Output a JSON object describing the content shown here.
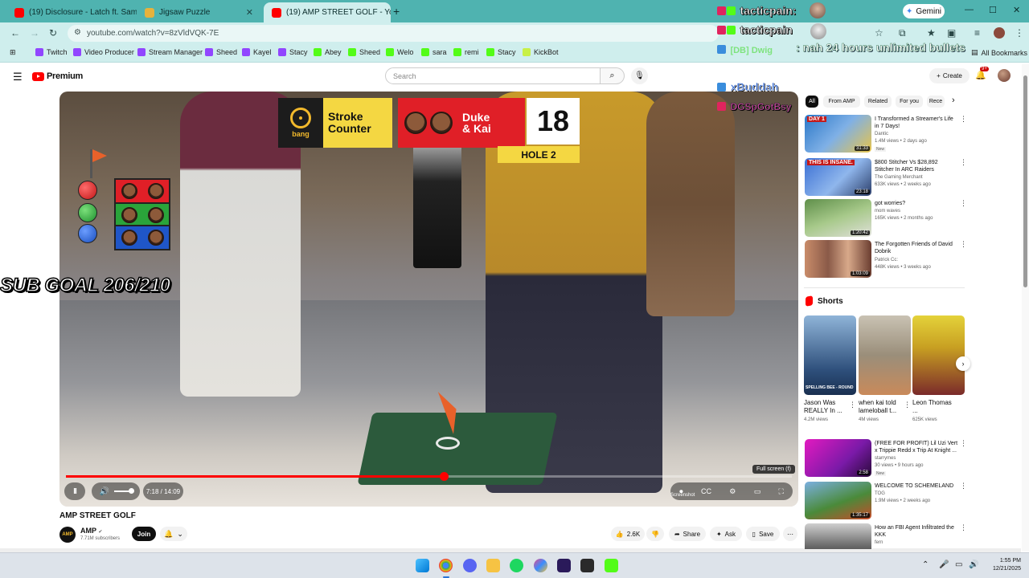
{
  "browser": {
    "tabs": [
      {
        "title": "(19) Disclosure - Latch ft. Sam S",
        "active": false
      },
      {
        "title": "Jigsaw Puzzle",
        "active": false
      },
      {
        "title": "(19) AMP STREET GOLF - Yo",
        "active": true
      }
    ],
    "new_tab": "+",
    "gemini_label": "Gemini",
    "url": "youtube.com/watch?v=8zVldVQK-7E",
    "window_controls": {
      "minimize": "—",
      "maximize": "☐",
      "close": "✕"
    }
  },
  "bookmarks": [
    {
      "label": "Twitch",
      "color": "#9146ff"
    },
    {
      "label": "Video Producer",
      "color": "#9146ff"
    },
    {
      "label": "Stream Manager",
      "color": "#9146ff"
    },
    {
      "label": "Sheed",
      "color": "#9146ff"
    },
    {
      "label": "Kayel",
      "color": "#9146ff"
    },
    {
      "label": "Stacy",
      "color": "#9146ff"
    },
    {
      "label": "Abey",
      "color": "#53fc18"
    },
    {
      "label": "Sheed",
      "color": "#53fc18"
    },
    {
      "label": "Welo",
      "color": "#53fc18"
    },
    {
      "label": "sara",
      "color": "#53fc18"
    },
    {
      "label": "remi",
      "color": "#53fc18"
    },
    {
      "label": "Stacy",
      "color": "#53fc18"
    },
    {
      "label": "KickBot",
      "color": "#c8f046"
    }
  ],
  "bookmarks_all": "All Bookmarks",
  "youtube": {
    "logo_text": "Premium",
    "search_placeholder": "Search",
    "create_label": "Create",
    "notif_count": "9+"
  },
  "player": {
    "overlay": {
      "stroke_counter_line1": "Stroke",
      "stroke_counter_line2": "Counter",
      "bang_text": "bang",
      "team_line1": "Duke",
      "team_line2": "& Kai",
      "score": "18",
      "hole": "HOLE 2"
    },
    "sub_goal": "SUB GOAL 206/210",
    "progress": 0.52,
    "time": "7:18 / 14:09",
    "tooltip_fullscreen": "Full screen (f)",
    "tooltip_screenshot": "Screenshot",
    "pause_glyph": "II",
    "controls_glyphs": [
      "⏺",
      "CC",
      "⚙",
      "▭",
      "⛶"
    ]
  },
  "video": {
    "title": "AMP STREET GOLF",
    "channel": "AMP",
    "channel_avatar_text": "AMP",
    "subscribers": "7.71M subscribers",
    "join_label": "Join",
    "likes": "2.6K",
    "share_label": "Share",
    "ask_label": "Ask",
    "save_label": "Save"
  },
  "sidebar": {
    "chips": [
      "All",
      "From AMP",
      "Related",
      "For you",
      "Rece"
    ],
    "recommendations": [
      {
        "title": "I Transformed a Streamer's Life in 7 Days!",
        "channel": "Dantic",
        "meta": "1.4M views • 2 days ago",
        "badge": "New",
        "duration": "31:33",
        "thumb_text": "DAY 1"
      },
      {
        "title": "$800 Stitcher Vs $28,892 Stitcher In ARC Raiders",
        "channel": "The Gaming Merchant",
        "meta": "633K views • 2 weeks ago",
        "badge": "",
        "duration": "23:18",
        "thumb_text": "THIS IS INSANE."
      },
      {
        "title": "got worries?",
        "channel": "mom waves",
        "meta": "165K views • 2 months ago",
        "badge": "",
        "duration": "1:20:42",
        "thumb_text": ""
      },
      {
        "title": "The Forgotten Friends of David Dobrik",
        "channel": "Patrick Cc:",
        "meta": "448K views • 3 weeks ago",
        "badge": "",
        "duration": "1:03:09",
        "thumb_text": ""
      }
    ],
    "shorts_title": "Shorts",
    "shorts": [
      {
        "title": "Jason Was REALLY In ...",
        "views": "4.2M views",
        "thumb_text": "SPELLING BEE - ROUND"
      },
      {
        "title": "when kai told lameloball t...",
        "views": "4M views",
        "thumb_text": ""
      },
      {
        "title": "Leon Thomas ...",
        "views": "625K views",
        "thumb_text": ""
      }
    ],
    "more": [
      {
        "title": "(FREE FOR PROFIT) Lil Uzi Vert x Trippie Redd x Trip At Knight ...",
        "channel": "starrymes",
        "meta": "30 views • 9 hours ago",
        "badge": "New",
        "duration": "2:58"
      },
      {
        "title": "WELCOME TO SCHEMELAND",
        "channel": "TOG",
        "meta": "1.9M views • 2 weeks ago",
        "badge": "",
        "duration": "1:35:17"
      },
      {
        "title": "How an FBI Agent Infiltrated the KKK",
        "channel": "fern",
        "meta": "",
        "badge": "",
        "duration": ""
      }
    ]
  },
  "stream_chat": {
    "lines": [
      {
        "user": "tacticpain:",
        "color": "#ffffff"
      },
      {
        "user": "tacticpain",
        "color": "#ffffff"
      }
    ],
    "message_user": "[DB] Dwig",
    "message_text": ": nah 24 hours unlimited bullets",
    "user3": "xBuddah",
    "user4": "DGSpGotBsy"
  },
  "taskbar": {
    "time": "1:55 PM",
    "date": "12/21/2025"
  }
}
